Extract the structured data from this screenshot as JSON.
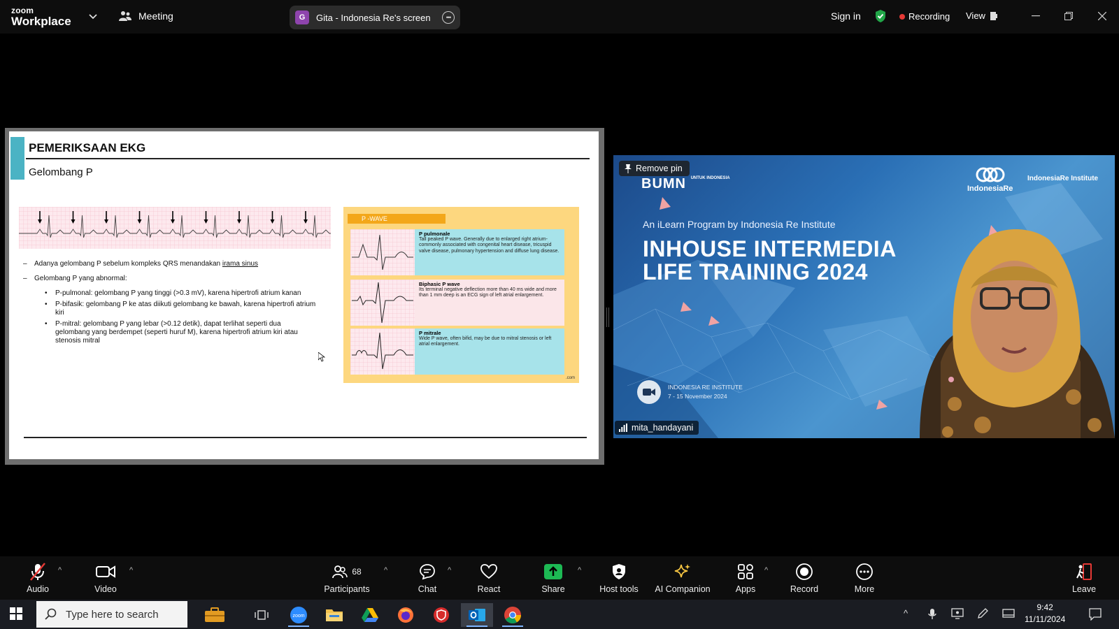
{
  "titlebar": {
    "logo_small": "zoom",
    "logo_big": "Workplace",
    "meeting_label": "Meeting",
    "share_badge": "G",
    "share_title": "Gita - Indonesia Re's screen",
    "sign_in": "Sign in",
    "recording": "Recording",
    "view": "View"
  },
  "slide": {
    "title": "PEMERIKSAAN EKG",
    "subtitle": "Gelombang P",
    "bullet1_prefix": "Adanya gelombang P sebelum kompleks QRS menandakan ",
    "bullet1_link": "irama sinus",
    "bullet2": "Gelombang P yang abnormal:",
    "sub_bullets": [
      "P-pulmonal: gelombang P yang tinggi (>0.3 mV), karena hipertrofi atrium kanan",
      "P-bifasik: gelombang P ke atas diikuti gelombang ke bawah, karena hipertrofi atrium kiri",
      "P-mitral: gelombang P yang lebar (>0.12 detik), dapat terlihat seperti dua gelombang yang berdempet (seperti huruf M), karena hipertrofi atrium kiri atau stenosis mitral"
    ],
    "pwave": {
      "tab": "P -WAVE",
      "rows": [
        {
          "title": "P pulmonale",
          "text": "Tall peaked P wave. Generally due to enlarged right atrium- commonly associated with congenital heart disease, tricuspid valve disease, pulmonary hypertension and diffuse lung disease."
        },
        {
          "title": "Biphasic P wave",
          "text": "Its terminal negative deflection more than 40 ms wide and more than 1 mm deep is an ECG sign of left atrial enlargement."
        },
        {
          "title": "P mitrale",
          "text": "Wide P wave, often bifid, may be due to mitral stenosis or left atrial enlargement."
        }
      ],
      "footer": ".com"
    }
  },
  "video": {
    "remove_pin": "Remove pin",
    "bumn": "BUMN",
    "bumn_small": "UNTUK INDONESIA",
    "ire_logo": "IndonesiaRe",
    "ire_institute": "IndonesiaRe Institute",
    "tagline": "An iLearn Program by Indonesia Re Institute",
    "title_line1": "INHOUSE INTERMEDIA",
    "title_line2": "LIFE TRAINING 2024",
    "inst_line1": "INDONESIA RE INSTITUTE",
    "inst_line2": "7 - 15 November 2024",
    "participant_name": "mita_handayani"
  },
  "toolbar": {
    "audio": "Audio",
    "video": "Video",
    "participants": "Participants",
    "participants_count": "68",
    "chat": "Chat",
    "react": "React",
    "share": "Share",
    "host_tools": "Host tools",
    "ai_companion": "AI Companion",
    "apps": "Apps",
    "record": "Record",
    "more": "More",
    "leave": "Leave"
  },
  "taskbar": {
    "search_placeholder": "Type here to search",
    "time": "9:42",
    "date": "11/11/2024"
  },
  "colors": {
    "accent_teal": "#4bb3c4",
    "recording_red": "#e53935",
    "share_green": "#1db954",
    "shield_green": "#21a648"
  }
}
